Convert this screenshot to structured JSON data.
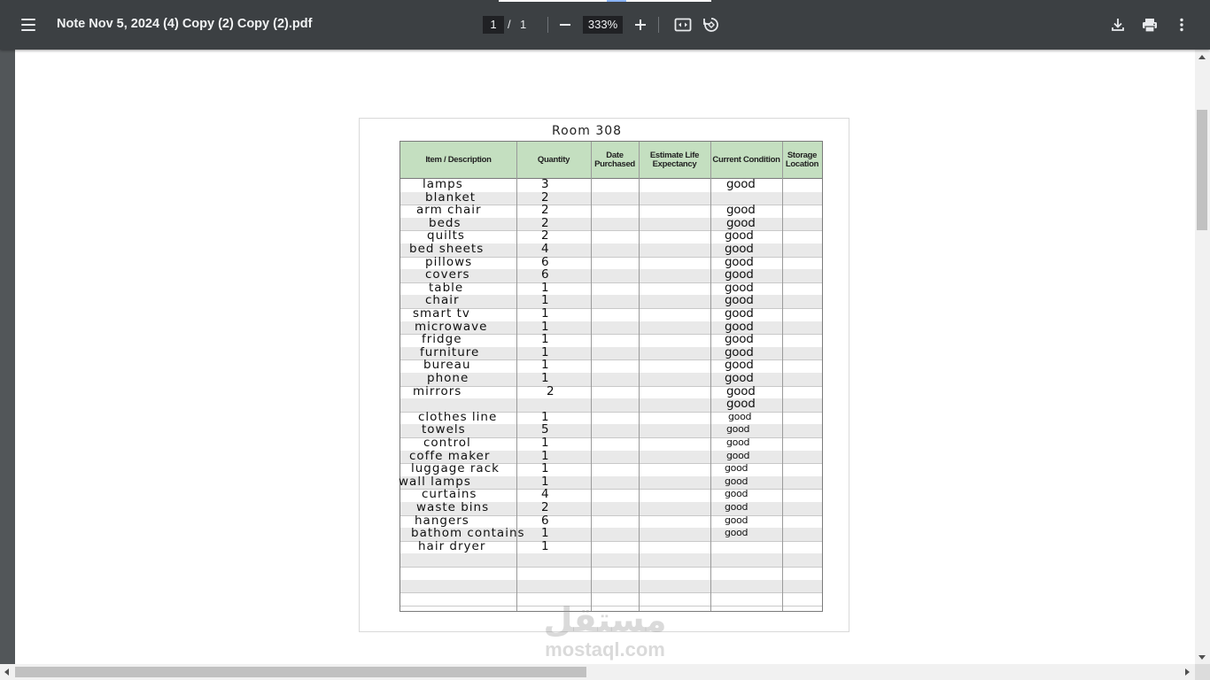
{
  "toolbar": {
    "title": "Note Nov 5, 2024 (4) Copy (2) Copy (2).pdf",
    "page_current": "1",
    "page_separator": "/",
    "page_total": "1",
    "zoom": "333%",
    "icons": [
      "menu-icon",
      "zoom-out-icon",
      "zoom-in-icon",
      "fit-page-icon",
      "rotate-icon",
      "download-icon",
      "print-icon",
      "more-options-icon"
    ]
  },
  "document": {
    "heading": "Room 308",
    "columns": [
      "Item / Description",
      "Quantity",
      "Date Purchased",
      "Estimate Life Expectancy",
      "Current Condition",
      "Storage Location"
    ],
    "rows": [
      {
        "item": "lamps",
        "qty": "3",
        "cond": "good"
      },
      {
        "item": "blanket",
        "qty": "2",
        "cond": ""
      },
      {
        "item": "arm chair",
        "qty": "2",
        "cond": "good"
      },
      {
        "item": "beds",
        "qty": "2",
        "cond": "good"
      },
      {
        "item": "quilts",
        "qty": "2",
        "cond": "good"
      },
      {
        "item": "bed sheets",
        "qty": "4",
        "cond": "good"
      },
      {
        "item": "pillows",
        "qty": "6",
        "cond": "good"
      },
      {
        "item": "covers",
        "qty": "6",
        "cond": "good"
      },
      {
        "item": "table",
        "qty": "1",
        "cond": "good"
      },
      {
        "item": "chair",
        "qty": "1",
        "cond": "good"
      },
      {
        "item": "smart tv",
        "qty": "1",
        "cond": "good"
      },
      {
        "item": "microwave",
        "qty": "1",
        "cond": "good"
      },
      {
        "item": "fridge",
        "qty": "1",
        "cond": "good"
      },
      {
        "item": "furniture",
        "qty": "1",
        "cond": "good"
      },
      {
        "item": "bureau",
        "qty": "1",
        "cond": "good"
      },
      {
        "item": "phone",
        "qty": "1",
        "cond": "good"
      },
      {
        "item": "mirrors",
        "qty": "2",
        "cond": "good"
      },
      {
        "item": "",
        "qty": "",
        "cond": "good"
      },
      {
        "item": "clothes line",
        "qty": "1",
        "cond": "good"
      },
      {
        "item": "towels",
        "qty": "5",
        "cond": "good"
      },
      {
        "item": "control",
        "qty": "1",
        "cond": "good"
      },
      {
        "item": "coffe maker",
        "qty": "1",
        "cond": "good"
      },
      {
        "item": "luggage rack",
        "qty": "1",
        "cond": "good"
      },
      {
        "item": "wall lamps",
        "qty": "1",
        "cond": "good"
      },
      {
        "item": "curtains",
        "qty": "4",
        "cond": "good"
      },
      {
        "item": "waste bins",
        "qty": "2",
        "cond": "good"
      },
      {
        "item": "hangers",
        "qty": "6",
        "cond": "good"
      },
      {
        "item": "bathom contains",
        "qty": "1",
        "cond": "good"
      },
      {
        "item": "hair dryer",
        "qty": "1",
        "cond": ""
      }
    ]
  },
  "watermark": {
    "arabic": "مستقل",
    "latin": "mostaql.com"
  },
  "colors": {
    "toolbar_bg": "#3c4043",
    "viewport_bg": "#525659",
    "header_green": "#c4dfc0"
  }
}
